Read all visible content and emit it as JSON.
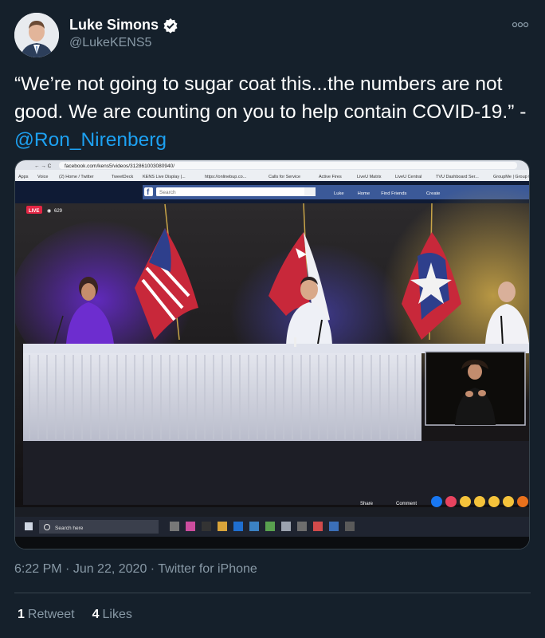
{
  "tweet": {
    "author_name": "Luke Simons",
    "handle": "@LukeKENS5",
    "verified_icon": "verified-badge-icon",
    "more_icon": "more-options-icon",
    "text_main": "“We’re not going to sugar coat this...the numbers are not good. We are counting on you to help contain COVID-19.” -",
    "mention": "@Ron_Nirenberg",
    "time": "6:22 PM",
    "sep1": " · ",
    "date": "Jun 22, 2020",
    "sep2": " · ",
    "source": "Twitter for iPhone",
    "retweets_count": "1",
    "retweets_label": "Retweet",
    "likes_count": "4",
    "likes_label": "Likes"
  },
  "photo": {
    "url": "facebook.com/kens5/videos/312861003080940/",
    "bookmarks": [
      "Apps",
      "Voice",
      "(2) Home / Twitter",
      "TweetDeck",
      "KENS Live Display |...",
      "https://onlinebup.co...",
      "Calls for Service",
      "Active Fires",
      "LiveU Matrix",
      "LiveU Central",
      "TVU Dashboard Ser...",
      "GroupMe | Group t..."
    ],
    "fb_search": "Search",
    "fb_nav": [
      "Luke",
      "Home",
      "Find Friends",
      "Create"
    ],
    "live_badge": "LIVE",
    "viewer_count": "629",
    "share_label": "Share",
    "comment_label": "Comment",
    "taskbar_search": "Search here"
  },
  "colors": {
    "background": "#15202b",
    "text_primary": "#ffffff",
    "text_secondary": "#8899a6",
    "link": "#1da1f2",
    "divider": "#38444d"
  }
}
